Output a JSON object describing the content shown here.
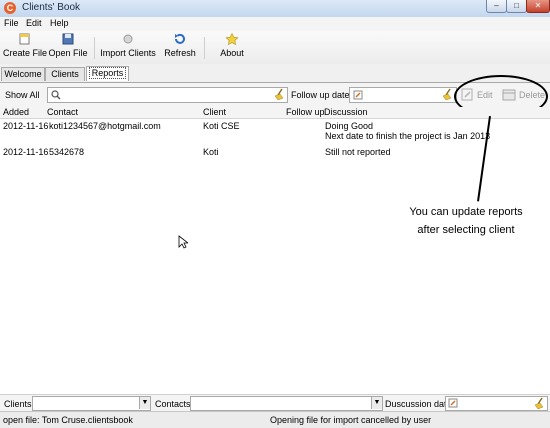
{
  "window": {
    "title": "Clients' Book",
    "app_icon": "C"
  },
  "menu": [
    "File",
    "Edit",
    "Help"
  ],
  "toolbar": {
    "create_file": "Create File",
    "open_file": "Open File",
    "import_clients": "Import Clients",
    "refresh": "Refresh",
    "about": "About"
  },
  "tabs": [
    "Welcome",
    "Clients",
    "Reports"
  ],
  "filter": {
    "show_all": "Show All",
    "follow_up_date_label": "Follow up date",
    "edit": "Edit",
    "delete": "Delete"
  },
  "table": {
    "columns": [
      "Added",
      "Contact",
      "Client",
      "Follow up",
      "Discussion"
    ],
    "rows": [
      {
        "added": "2012-11-16",
        "contact": "koti1234567@hotgmail.com",
        "client": "Koti CSE",
        "follow_up": "",
        "discussion": [
          "Doing Good",
          "Next date to finish the project is Jan 2013"
        ]
      },
      {
        "added": "2012-11-16",
        "contact": "5342678",
        "client": "Koti",
        "follow_up": "",
        "discussion": [
          "Still not reported"
        ]
      }
    ]
  },
  "annotation": {
    "line1": "You can update reports",
    "line2": "after selecting client"
  },
  "bottom": {
    "clients": "Clients",
    "contacts": "Contacts",
    "discussion_date": "Duscussion date"
  },
  "status": {
    "left": "open file: Tom Cruse.clientsbook",
    "right": "Opening file for import cancelled by user"
  },
  "colors": {
    "titlebar": "#c3d7ee",
    "app_icon": "#e8632c",
    "close": "#c5412b"
  }
}
